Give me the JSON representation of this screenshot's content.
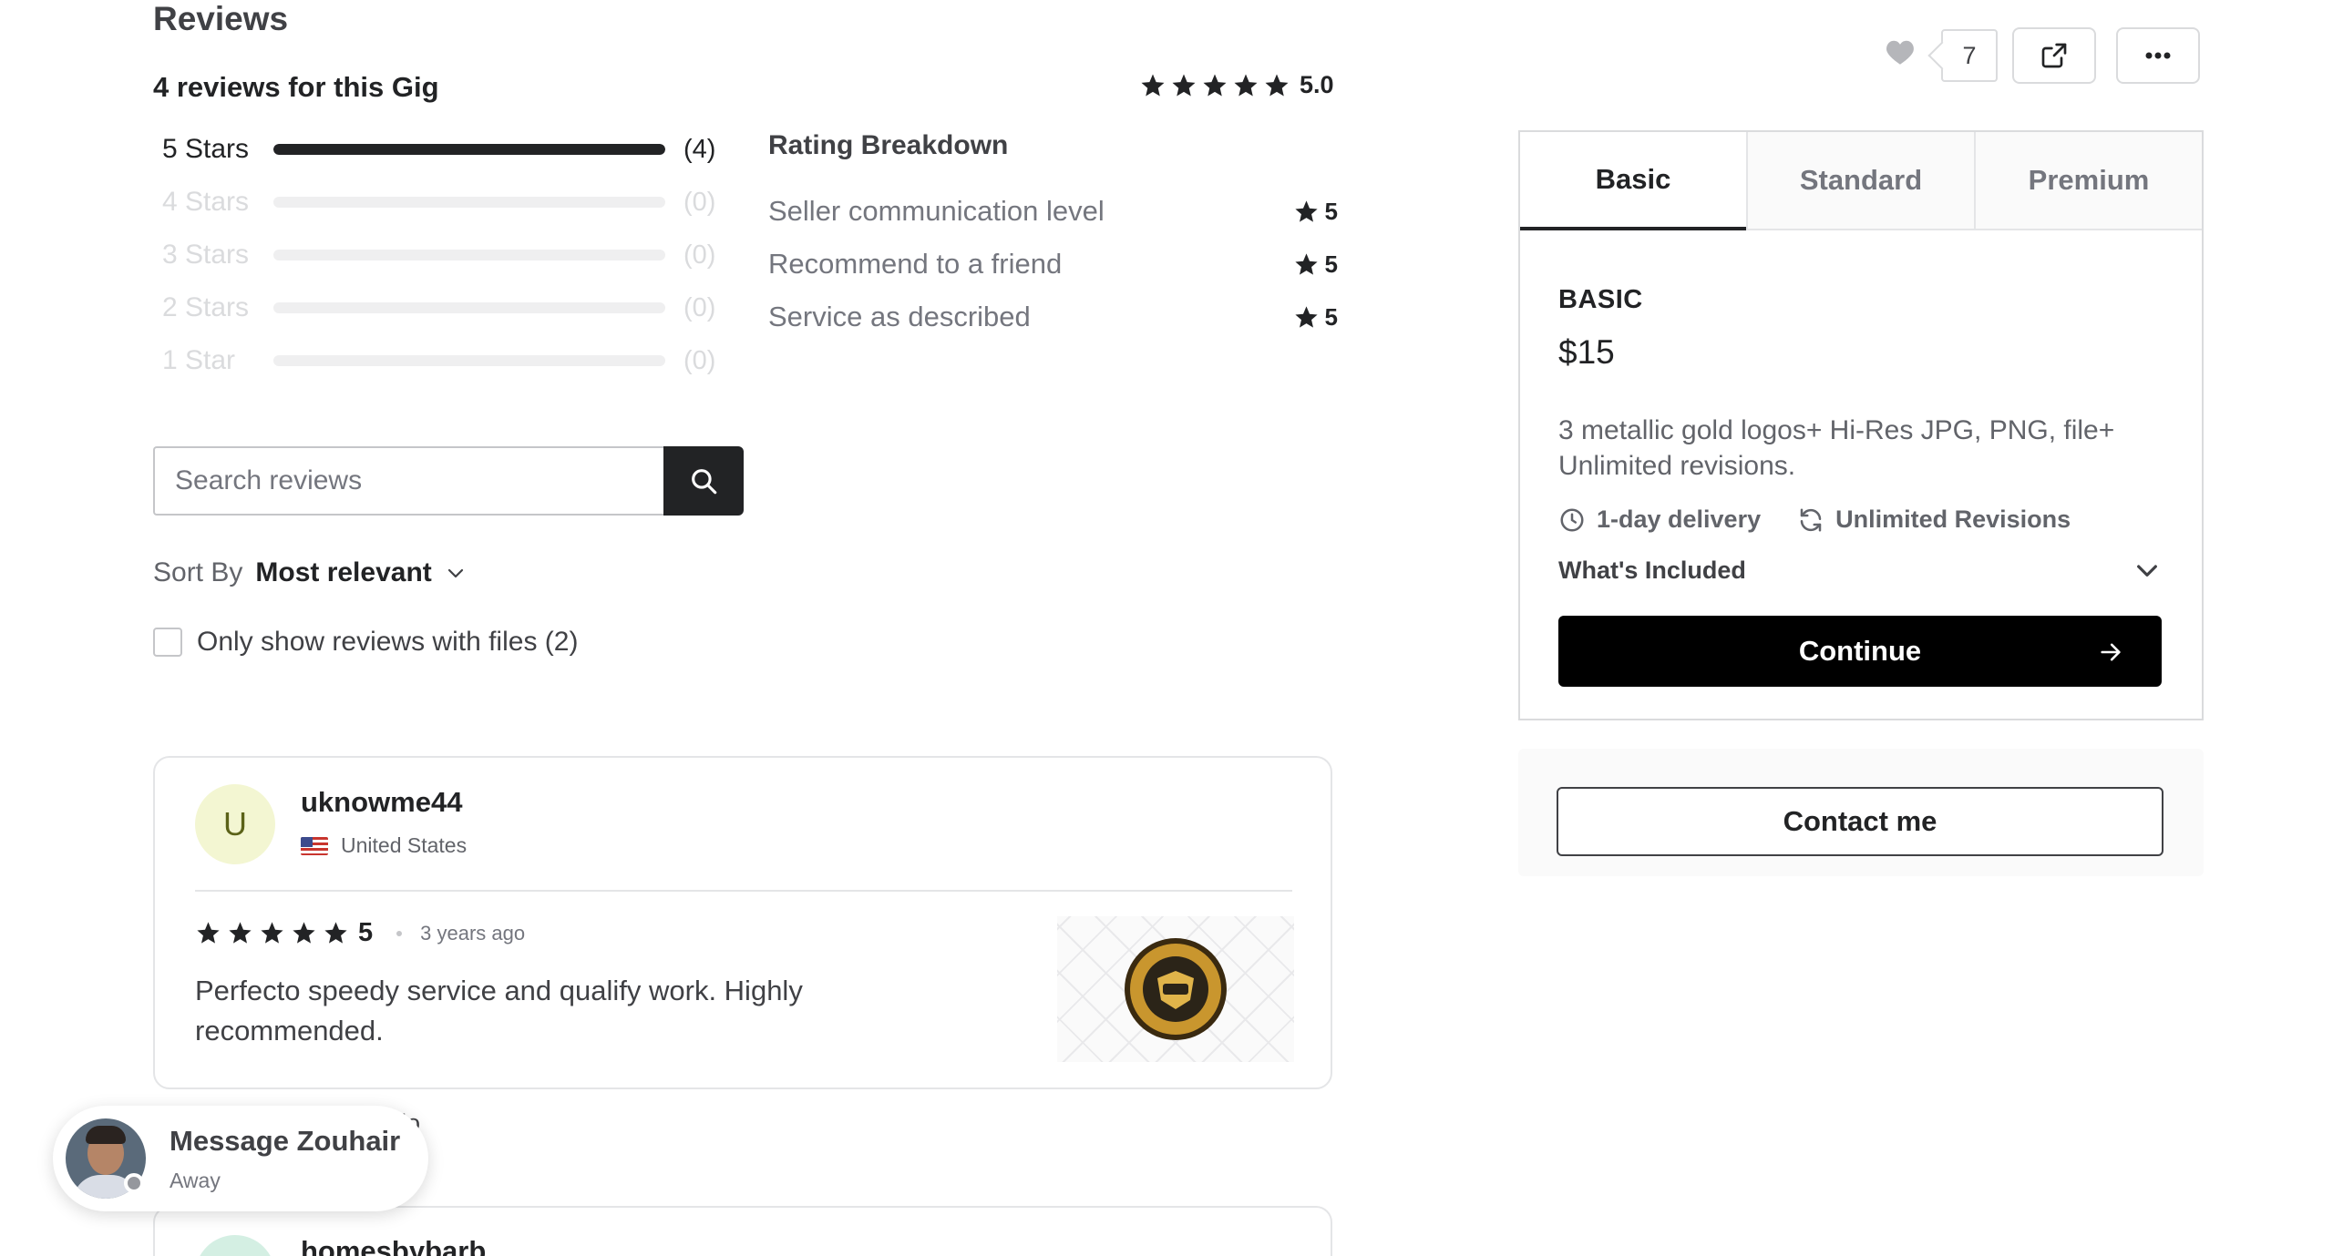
{
  "reviews": {
    "heading": "Reviews",
    "count_label": "4 reviews for this Gig",
    "overall_rating": "5.0",
    "overall_stars": 5,
    "star_rows": [
      {
        "label": "5 Stars",
        "count": "(4)",
        "fraction": 1.0,
        "muted": false
      },
      {
        "label": "4 Stars",
        "count": "(0)",
        "fraction": 0.0,
        "muted": true
      },
      {
        "label": "3 Stars",
        "count": "(0)",
        "fraction": 0.0,
        "muted": true
      },
      {
        "label": "2 Stars",
        "count": "(0)",
        "fraction": 0.0,
        "muted": true
      },
      {
        "label": "1 Star",
        "count": "(0)",
        "fraction": 0.0,
        "muted": true
      }
    ],
    "breakdown": {
      "title": "Rating Breakdown",
      "items": [
        {
          "label": "Seller communication level",
          "value": "5"
        },
        {
          "label": "Recommend to a friend",
          "value": "5"
        },
        {
          "label": "Service as described",
          "value": "5"
        }
      ]
    },
    "search": {
      "placeholder": "Search reviews"
    },
    "sort": {
      "label": "Sort By",
      "value": "Most relevant"
    },
    "files_filter": {
      "label": "Only show reviews with files (2)",
      "checked": false
    },
    "items": [
      {
        "avatar_letter": "U",
        "username": "uknowme44",
        "country": "United States",
        "rating": "5",
        "time_ago": "3 years ago",
        "text": "Perfecto speedy service and qualify work. Highly recommended."
      },
      {
        "username": "homesbybarb"
      }
    ],
    "helpful_partial": "lo"
  },
  "chat": {
    "title": "Message Zouhair",
    "status": "Away"
  },
  "actions": {
    "like_count": "7"
  },
  "package": {
    "tabs": [
      "Basic",
      "Standard",
      "Premium"
    ],
    "active_tab": 0,
    "name": "BASIC",
    "price": "$15",
    "description": "3 metallic gold logos+ Hi-Res JPG, PNG, file+ Unlimited revisions.",
    "delivery": "1-day delivery",
    "revisions": "Unlimited Revisions",
    "included_label": "What's Included",
    "continue_label": "Continue",
    "contact_label": "Contact me"
  },
  "colors": {
    "primary_text": "#222325",
    "muted_text": "#74767e",
    "button_black": "#000000",
    "avatar_bg": "#f3f6d2"
  }
}
